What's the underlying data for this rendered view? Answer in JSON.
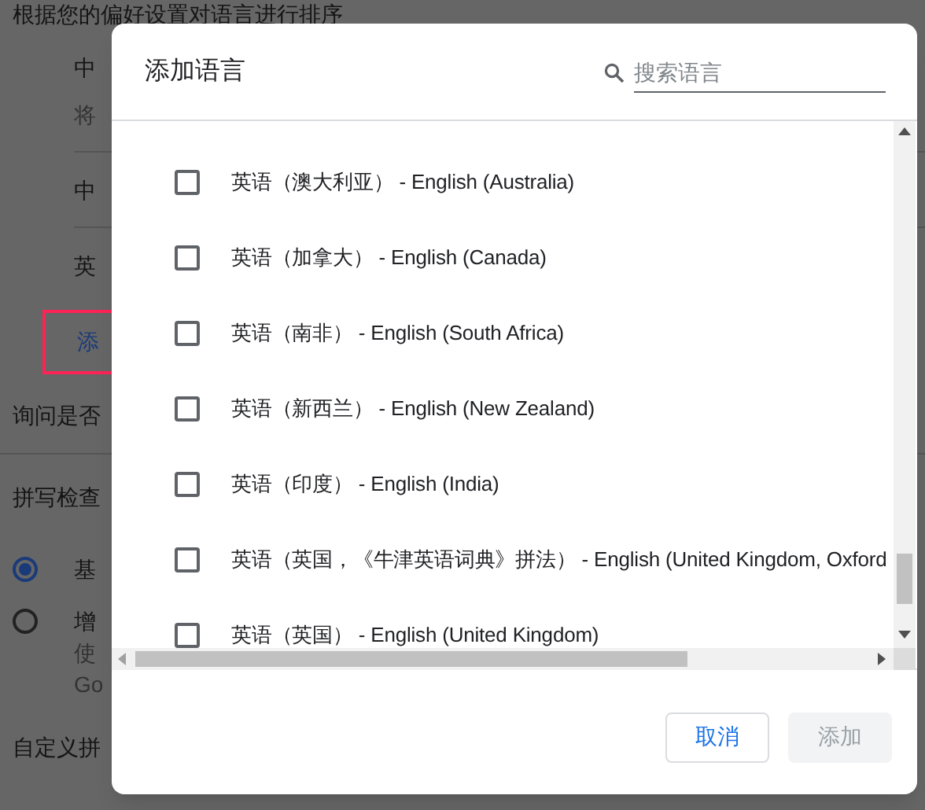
{
  "background_page": {
    "heading": "根据您的偏好设置对语言进行排序",
    "languages": [
      {
        "name": "中",
        "description": "将"
      },
      {
        "name": "中"
      },
      {
        "name": "英"
      }
    ],
    "add_link": {
      "label": "添",
      "highlighted": true
    },
    "translate_prompt": "询问是否",
    "spell_check": {
      "title": "拼写检查",
      "options": [
        {
          "label": "基",
          "selected": true
        },
        {
          "label": "增",
          "description_lines": [
            "使",
            "Go"
          ],
          "selected": false
        }
      ]
    },
    "custom_spelling": "自定义拼"
  },
  "dialog": {
    "title": "添加语言",
    "search": {
      "placeholder": "搜索语言"
    },
    "languages": [
      {
        "label": "英语（澳大利亚） - English (Australia)",
        "checked": false
      },
      {
        "label": "英语（加拿大） - English (Canada)",
        "checked": false
      },
      {
        "label": "英语（南非） - English (South Africa)",
        "checked": false
      },
      {
        "label": "英语（新西兰） - English (New Zealand)",
        "checked": false
      },
      {
        "label": "英语（印度） - English (India)",
        "checked": false
      },
      {
        "label": "英语（英国，《牛津英语词典》拼法） - English (United Kingdom, Oxford",
        "checked": false
      },
      {
        "label": "英语（英国） - English (United Kingdom)",
        "checked": false
      }
    ],
    "buttons": [
      {
        "label": "取消",
        "kind": "secondary",
        "disabled": false
      },
      {
        "label": "添加",
        "kind": "primary",
        "disabled": true
      }
    ]
  }
}
